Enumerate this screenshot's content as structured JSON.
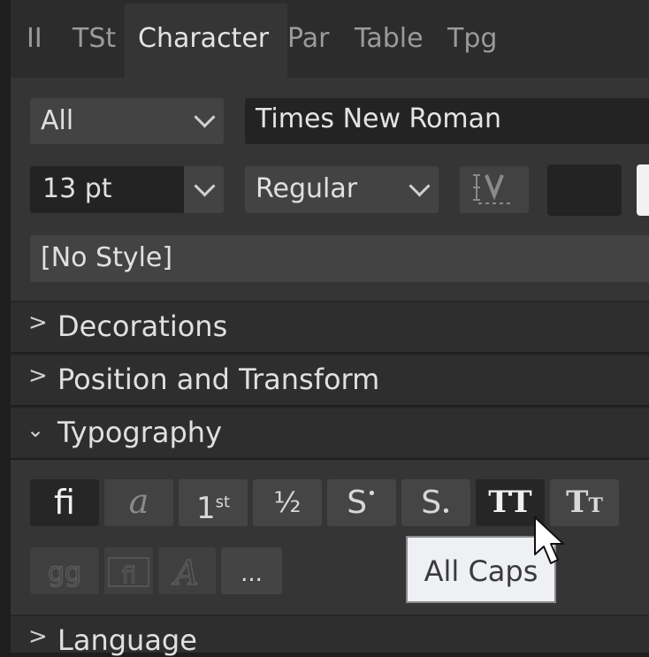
{
  "tabs": [
    {
      "label": "II"
    },
    {
      "label": "TSt"
    },
    {
      "label": "Character"
    },
    {
      "label": "Par"
    },
    {
      "label": "Table"
    },
    {
      "label": "Tpg"
    }
  ],
  "active_tab": "Character",
  "character": {
    "language_scope": "All",
    "font_family": "Times New Roman",
    "font_size": "13 pt",
    "font_style": "Regular",
    "character_style": "[No Style]",
    "text_color": "#232323"
  },
  "sections": [
    {
      "label": "Decorations",
      "expanded": false
    },
    {
      "label": "Position and Transform",
      "expanded": false
    },
    {
      "label": "Typography",
      "expanded": true
    },
    {
      "label": "Language",
      "expanded": false
    }
  ],
  "typography_buttons": [
    {
      "name": "ligatures",
      "glyph": "fi",
      "active": true
    },
    {
      "name": "stylistic-alternates",
      "glyph": "a",
      "active": false
    },
    {
      "name": "ordinals",
      "glyph": "1st",
      "active": false
    },
    {
      "name": "fractions",
      "glyph": "½",
      "active": false
    },
    {
      "name": "superscript",
      "glyph": "S•",
      "active": false
    },
    {
      "name": "subscript",
      "glyph": "S.",
      "active": false
    },
    {
      "name": "all-caps",
      "glyph": "TT",
      "active": true
    },
    {
      "name": "small-caps",
      "glyph": "Tt",
      "active": false
    }
  ],
  "more_button_label": "...",
  "tooltip": "All Caps"
}
